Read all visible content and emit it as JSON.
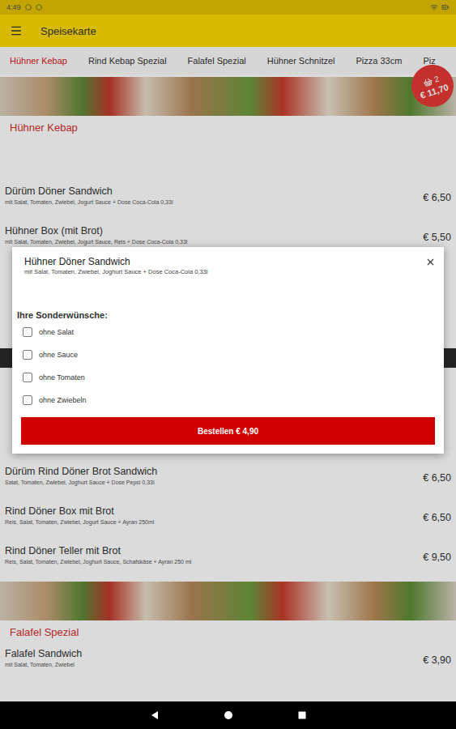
{
  "status_bar": {
    "time": "4:49"
  },
  "app_bar": {
    "title": "Speisekarte"
  },
  "tabs": [
    {
      "label": "Hühner Kebap",
      "selected": true
    },
    {
      "label": "Rind Kebap Spezial",
      "selected": false
    },
    {
      "label": "Falafel Spezial",
      "selected": false
    },
    {
      "label": "Hühner Schnitzel",
      "selected": false
    },
    {
      "label": "Pizza 33cm",
      "selected": false
    },
    {
      "label": "Piz",
      "selected": false
    }
  ],
  "cart": {
    "count": "2",
    "total": "€ 11,70"
  },
  "menu": {
    "first_section": {
      "title": "Hühner Kebap",
      "items": [
        {
          "name": "Dürüm Döner Sandwich",
          "description": "mit Salat, Tomaten, Zwiebel, Jogurt Sauce + Dose Coca-Cola 0,33l",
          "price": "€ 6,50"
        },
        {
          "name": "Hühner Box (mit Brot)",
          "description": "mit Salat, Tomaten, Zwiebel, Jogurt Sauce, Reis + Dose Coca-Cola 0,33l",
          "price": "€ 5,50"
        }
      ]
    },
    "continued_items": [
      {
        "name": "Dürüm Rind Döner Brot Sandwich",
        "description": "Salat, Tomaten, Zwiebel, Joghurt Sauce + Dose Pepsi 0,33l",
        "price": "€ 6,50"
      },
      {
        "name": "Rind Döner Box mit Brot",
        "description": "Reis, Salat, Tomaten, Zwiebel, Jogurt Sauce + Ayran 250ml",
        "price": "€ 6,50"
      },
      {
        "name": "Rind Döner Teller mit Brot",
        "description": "Reis, Salat, Tomaten, Zwiebel, Joghurt Sauce, Schafskäse + Ayran 250 ml",
        "price": "€ 9,50"
      }
    ],
    "next_section": {
      "title": "Falafel Spezial",
      "items": [
        {
          "name": "Falafel Sandwich",
          "description": "mit Salat, Tomaten, Zwiebel",
          "price": "€ 3,90"
        }
      ]
    }
  },
  "dialog": {
    "title": "Hühner Döner Sandwich",
    "description": "mit Salat, Tomaten, Zwiebel, Joghurt Sauce + Dose Coca-Cola 0,33l",
    "options_heading": "Ihre Sonderwünsche:",
    "options": [
      {
        "label": "ohne Salat",
        "checked": false
      },
      {
        "label": "ohne Sauce",
        "checked": false
      },
      {
        "label": "ohne Tomaten",
        "checked": false
      },
      {
        "label": "ohne Zwiebeln",
        "checked": false
      }
    ],
    "button": "Bestellen € 4,90"
  }
}
